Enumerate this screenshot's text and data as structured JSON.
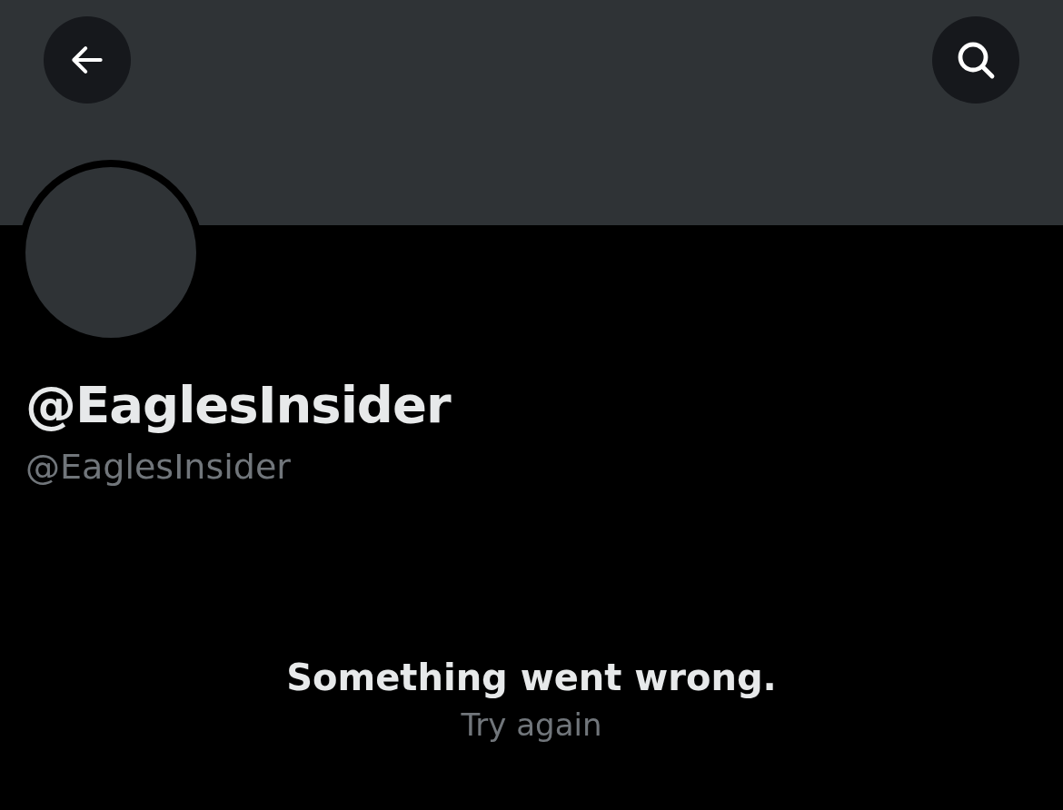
{
  "profile": {
    "display_name": "@EaglesInsider",
    "handle": "@EaglesInsider"
  },
  "error": {
    "message": "Something went wrong.",
    "retry": "Try again"
  }
}
